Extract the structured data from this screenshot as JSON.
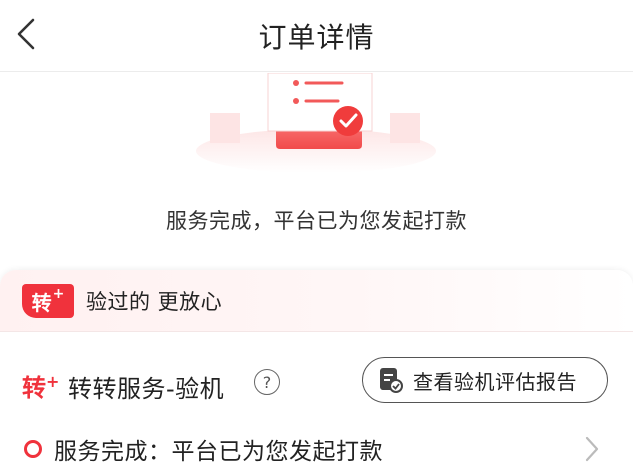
{
  "header": {
    "title": "订单详情"
  },
  "status": {
    "message": "服务完成，平台已为您发起打款"
  },
  "card": {
    "badge_char": "转",
    "badge_plus": "+",
    "banner_text": "验过的 更放心",
    "service": {
      "logo_char": "转",
      "logo_plus": "+",
      "name": "转转服务-验机",
      "help_glyph": "?",
      "report_button_label": "查看验机评估报告"
    },
    "progress": {
      "text": "服务完成：平台已为您发起打款"
    }
  },
  "colors": {
    "accent": "#f0323c",
    "text": "#222222"
  }
}
